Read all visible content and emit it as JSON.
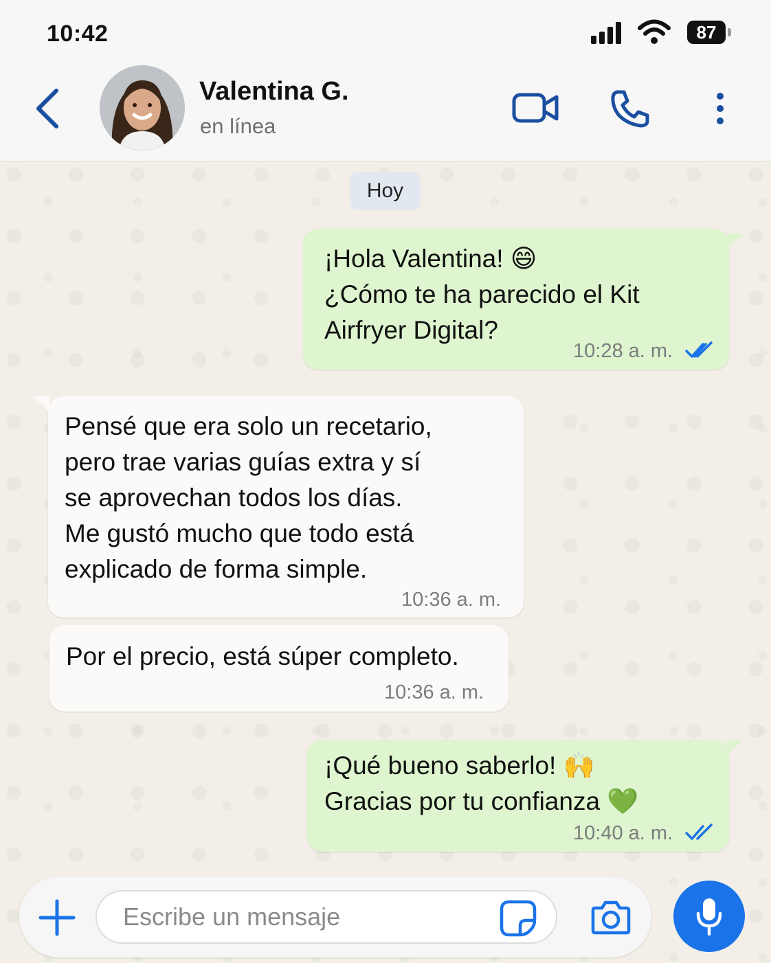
{
  "status_bar": {
    "time": "10:42",
    "battery": "87"
  },
  "header": {
    "contact_name": "Valentina G.",
    "contact_status": "en línea"
  },
  "day_label": "Hoy",
  "messages": [
    {
      "direction": "out",
      "text": "¡Hola Valentina! 😄\n¿Cómo te ha parecido el Kit\nAirfryer Digital?",
      "time": "10:28 a. m.",
      "status": "read"
    },
    {
      "direction": "in",
      "text": "Pensé que era solo un recetario,\npero trae varias guías extra y sí\nse aprovechan todos los días.\nMe gustó mucho que todo está\nexplicado de forma simple.",
      "time": "10:36 a. m."
    },
    {
      "direction": "in",
      "text": "Por el precio, está súper completo.",
      "time": "10:36 a. m."
    },
    {
      "direction": "out",
      "text": "¡Qué bueno saberlo! 🙌\nGracias por tu confianza 💚",
      "time": "10:40 a. m.",
      "status": "read"
    }
  ],
  "composer": {
    "placeholder": "Escribe un mensaje"
  },
  "colors": {
    "accent": "#1a73e8",
    "icon_blue": "#1a4fa0",
    "out_bubble": "#def5cf",
    "in_bubble": "#fbfaf8",
    "read_ticks": "#1a73e8"
  },
  "icons": [
    "back-arrow-icon",
    "video-call-icon",
    "phone-icon",
    "more-options-icon",
    "plus-icon",
    "sticker-icon",
    "camera-icon",
    "microphone-icon",
    "read-ticks-icon"
  ]
}
